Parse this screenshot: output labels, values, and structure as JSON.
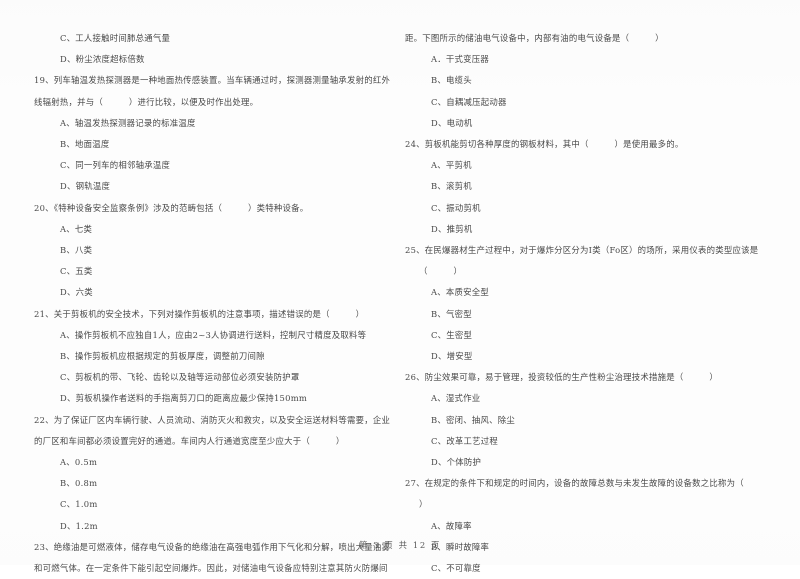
{
  "document": {
    "type": "scanned-exam-paper",
    "footer": "第 3 页 共 12 页"
  },
  "left_column": {
    "blocks": [
      {
        "kind": "option",
        "text": "C、工人接触时间肺总通气量"
      },
      {
        "kind": "option",
        "text": "D、粉尘浓度超标倍数"
      },
      {
        "kind": "stem",
        "text": "19、列车轴温发热探测器是一种地面热传感装置。当车辆通过时，探测器测量轴承发射的红外"
      },
      {
        "kind": "cont",
        "text": "线辐射热，并与（　　　）进行比较，以便及时作出处理。"
      },
      {
        "kind": "option",
        "text": "A、轴温发热探测器记录的标准温度"
      },
      {
        "kind": "option",
        "text": "B、地面温度"
      },
      {
        "kind": "option",
        "text": "C、同一列车的相邻轴承温度"
      },
      {
        "kind": "option",
        "text": "D、钢轨温度"
      },
      {
        "kind": "stem",
        "text": "20、《特种设备安全监察条例》涉及的范畴包括（　　　）类特种设备。"
      },
      {
        "kind": "option",
        "text": "A、七类"
      },
      {
        "kind": "option",
        "text": "B、八类"
      },
      {
        "kind": "option",
        "text": "C、五类"
      },
      {
        "kind": "option",
        "text": "D、六类"
      },
      {
        "kind": "stem",
        "text": "21、关于剪板机的安全技术，下列对操作剪板机的注意事项，描述错误的是（　　　）"
      },
      {
        "kind": "option",
        "text": "A、操作剪板机不应独自1人，应由2~3人协调进行送料，控制尺寸精度及取料等"
      },
      {
        "kind": "option",
        "text": "B、操作剪板机应根据规定的剪板厚度，调整前刀间隙"
      },
      {
        "kind": "option",
        "text": "C、剪板机的带、飞轮、齿轮以及轴等运动部位必须安装防护罩"
      },
      {
        "kind": "option",
        "text": "D、剪板机操作者送料的手指离剪刀口的距离应最少保持150mm"
      },
      {
        "kind": "stem",
        "text": "22、为了保证厂区内车辆行驶、人员流动、消防灭火和救灾，以及安全运送材料等需要，企业"
      },
      {
        "kind": "cont",
        "text": "的厂区和车间都必须设置完好的通道。车间内人行通道宽度至少应大于（　　　）"
      },
      {
        "kind": "option",
        "text": "A、0.5m"
      },
      {
        "kind": "option",
        "text": "B、0.8m"
      },
      {
        "kind": "option",
        "text": "C、1.0m"
      },
      {
        "kind": "option",
        "text": "D、1.2m"
      },
      {
        "kind": "stem",
        "text": "23、绝缘油是可燃液体，储存电气设备的绝缘油在高强电弧作用下气化和分解，喷出大量油雾"
      },
      {
        "kind": "cont",
        "text": "和可燃气体。在一定条件下能引起空间爆炸。因此，对储油电气设备应特别注意其防火防爆间"
      }
    ]
  },
  "right_column": {
    "blocks": [
      {
        "kind": "cont",
        "text": "距。下图所示的储油电气设备中，内部有油的电气设备是（　　　）"
      },
      {
        "kind": "option",
        "text": "A．干式变压器"
      },
      {
        "kind": "option",
        "text": "B、电缆头"
      },
      {
        "kind": "option",
        "text": "C、自耦减压起动器"
      },
      {
        "kind": "option",
        "text": "D、电动机"
      },
      {
        "kind": "stem",
        "text": "24、剪板机能剪切各种厚度的钢板材料，其中（　　　）是使用最多的。"
      },
      {
        "kind": "option",
        "text": "A、平剪机"
      },
      {
        "kind": "option",
        "text": "B、滚剪机"
      },
      {
        "kind": "option",
        "text": "C、振动剪机"
      },
      {
        "kind": "option",
        "text": "D、推剪机"
      },
      {
        "kind": "stem",
        "text": "25、在民爆器材生产过程中，对于爆炸分区分为Ⅰ类（Fo区）的场所，采用仪表的类型应该是"
      },
      {
        "kind": "short",
        "text": "（　　　）"
      },
      {
        "kind": "option",
        "text": "A、本质安全型"
      },
      {
        "kind": "option",
        "text": "B、气密型"
      },
      {
        "kind": "option",
        "text": "C、生密型"
      },
      {
        "kind": "option",
        "text": "D、增安型"
      },
      {
        "kind": "stem",
        "text": "26、防尘效果可靠，易于管理，投资较低的生产性粉尘治理技术措施是（　　　）"
      },
      {
        "kind": "option",
        "text": "A、湿式作业"
      },
      {
        "kind": "option",
        "text": "B、密闭、抽风、除尘"
      },
      {
        "kind": "option",
        "text": "C、改革工艺过程"
      },
      {
        "kind": "option",
        "text": "D、个体防护"
      },
      {
        "kind": "stem",
        "text": "27、在规定的条件下和规定的时间内，设备的故障总数与未发生故障的设备数之比称为（"
      },
      {
        "kind": "short",
        "text": "）"
      },
      {
        "kind": "option",
        "text": "A、故障率"
      },
      {
        "kind": "option",
        "text": "B、瞬时故障率"
      },
      {
        "kind": "option",
        "text": "C、不可靠度"
      }
    ]
  }
}
